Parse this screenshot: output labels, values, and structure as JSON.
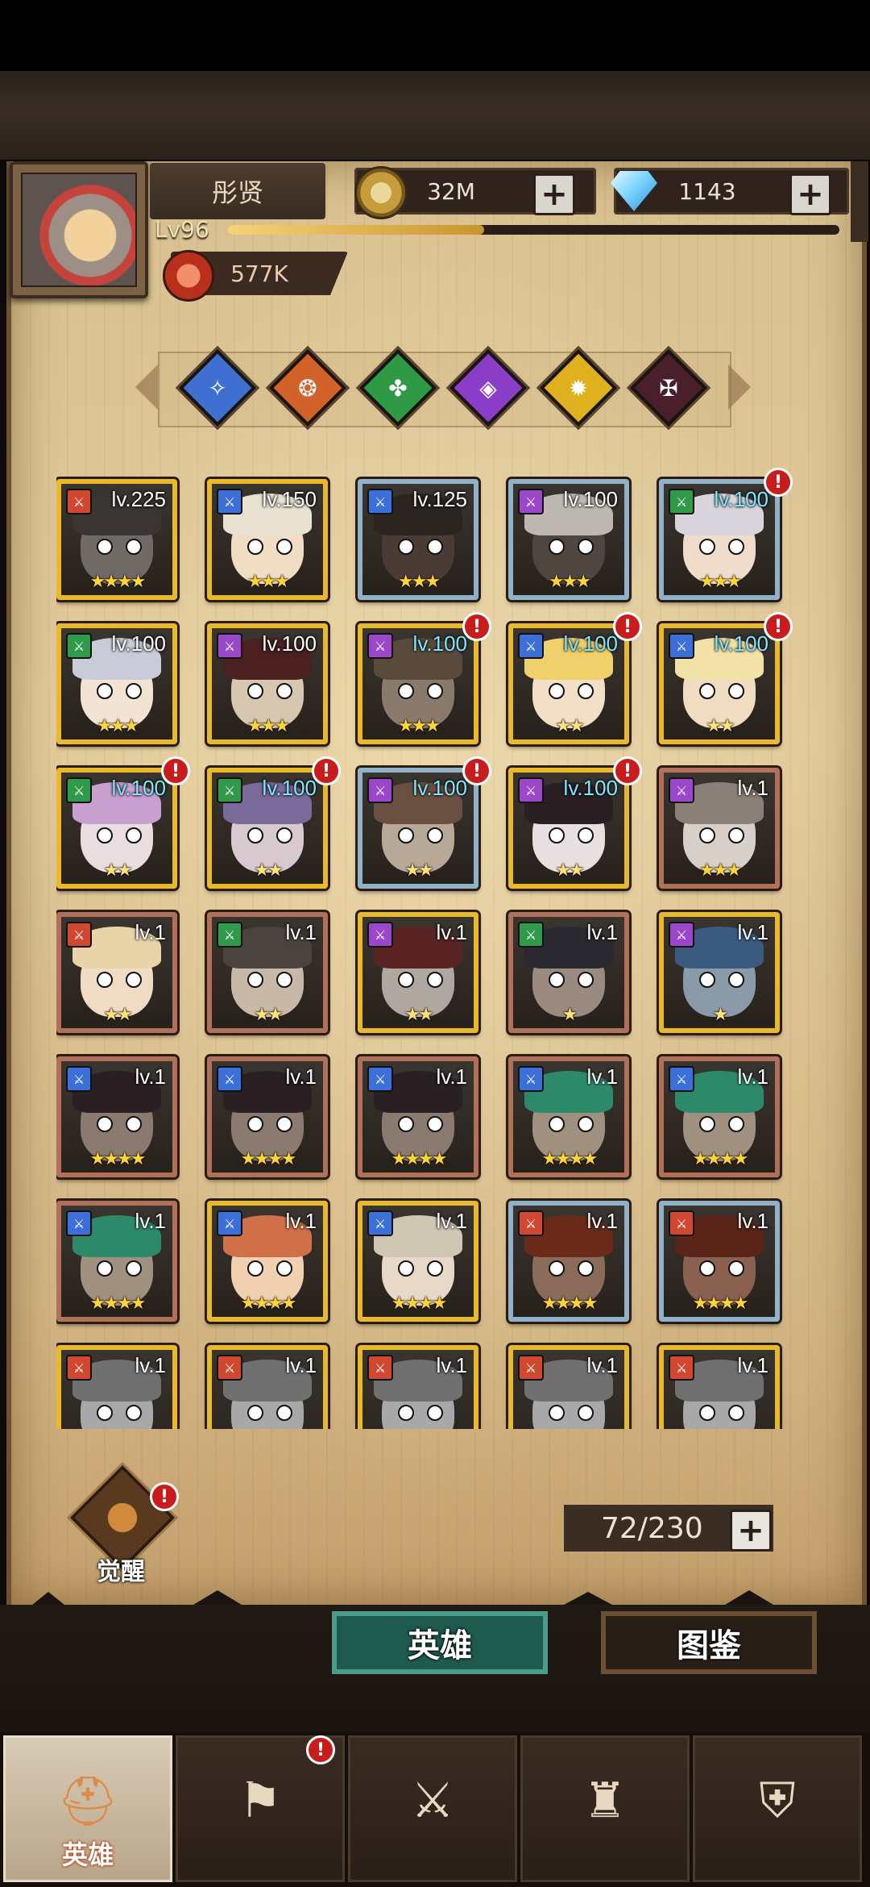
{
  "player": {
    "name": "彤贤",
    "level": "Lv96",
    "xp_fraction": 0.42,
    "power": "577K"
  },
  "currency": {
    "gold": "32M",
    "gems": "1143"
  },
  "factions": [
    {
      "name": "faction-blue",
      "color": "#3f6fd1",
      "glyph": "✧"
    },
    {
      "name": "faction-orange",
      "color": "#d2622a",
      "glyph": "❂"
    },
    {
      "name": "faction-green",
      "color": "#2f9a45",
      "glyph": "✤"
    },
    {
      "name": "faction-purple",
      "color": "#8a3ec7",
      "glyph": "◈"
    },
    {
      "name": "faction-yellow",
      "color": "#e0b11f",
      "glyph": "✹"
    },
    {
      "name": "faction-dark",
      "color": "#4a1e2a",
      "glyph": "✠"
    }
  ],
  "heroes": [
    {
      "level": "lv.225",
      "frame": "gold",
      "cls": "#d04830",
      "stars": 4,
      "badge": false,
      "hi": false,
      "skin": "#6f6a66",
      "hair": "#3a3533"
    },
    {
      "level": "lv.150",
      "frame": "gold",
      "cls": "#3c6fd8",
      "stars": 3,
      "badge": false,
      "hi": false,
      "skin": "#f1dcc4",
      "hair": "#e8e0d0"
    },
    {
      "level": "lv.125",
      "frame": "blue",
      "cls": "#3c6fd8",
      "stars": 3,
      "badge": false,
      "hi": false,
      "skin": "#4a3b35",
      "hair": "#2b2522"
    },
    {
      "level": "lv.100",
      "frame": "blue",
      "cls": "#9a48c9",
      "stars": 3,
      "badge": false,
      "hi": false,
      "skin": "#4f4640",
      "hair": "#bdb8b2"
    },
    {
      "level": "lv.100",
      "frame": "blue",
      "cls": "#2e9a4a",
      "stars": 3,
      "badge": true,
      "hi": true,
      "skin": "#f0dccb",
      "hair": "#d8d6dc"
    },
    {
      "level": "lv.100",
      "frame": "gold",
      "cls": "#2e9a4a",
      "stars": 3,
      "badge": false,
      "hi": false,
      "skin": "#f3e3d3",
      "hair": "#c9ccd8"
    },
    {
      "level": "lv.100",
      "frame": "gold",
      "cls": "#9a48c9",
      "stars": 3,
      "badge": false,
      "hi": false,
      "skin": "#d7c7b0",
      "hair": "#4b2020"
    },
    {
      "level": "lv.100",
      "frame": "gold",
      "cls": "#9a48c9",
      "stars": 3,
      "badge": true,
      "hi": true,
      "skin": "#8a7a6c",
      "hair": "#5a4a3c"
    },
    {
      "level": "lv.100",
      "frame": "gold",
      "cls": "#3c6fd8",
      "stars": 2,
      "badge": true,
      "hi": true,
      "skin": "#f3dfc6",
      "hair": "#f0d06a"
    },
    {
      "level": "lv.100",
      "frame": "gold",
      "cls": "#3c6fd8",
      "stars": 2,
      "badge": true,
      "hi": true,
      "skin": "#f0dcc0",
      "hair": "#f2e2a8"
    },
    {
      "level": "lv.100",
      "frame": "gold",
      "cls": "#2e9a4a",
      "stars": 2,
      "badge": true,
      "hi": true,
      "skin": "#eadde0",
      "hair": "#c8a0d0"
    },
    {
      "level": "lv.100",
      "frame": "gold",
      "cls": "#2e9a4a",
      "stars": 2,
      "badge": true,
      "hi": true,
      "skin": "#d8c8d0",
      "hair": "#7a6a9a"
    },
    {
      "level": "lv.100",
      "frame": "blue",
      "cls": "#9a48c9",
      "stars": 2,
      "badge": true,
      "hi": true,
      "skin": "#b8a898",
      "hair": "#6a5040"
    },
    {
      "level": "lv.100",
      "frame": "gold",
      "cls": "#9a48c9",
      "stars": 2,
      "badge": true,
      "hi": true,
      "skin": "#e8e0e0",
      "hair": "#2a2024"
    },
    {
      "level": "lv.1",
      "frame": "bronze",
      "cls": "#9a48c9",
      "stars": 3,
      "badge": false,
      "hi": false,
      "skin": "#d8d0c8",
      "hair": "#8a8078"
    },
    {
      "level": "lv.1",
      "frame": "bronze",
      "cls": "#d04830",
      "stars": 2,
      "badge": false,
      "hi": false,
      "skin": "#f0dcc4",
      "hair": "#e8d4a8"
    },
    {
      "level": "lv.1",
      "frame": "bronze",
      "cls": "#2e9a4a",
      "stars": 2,
      "badge": false,
      "hi": false,
      "skin": "#c8b8a8",
      "hair": "#4a4440"
    },
    {
      "level": "lv.1",
      "frame": "gold",
      "cls": "#9a48c9",
      "stars": 2,
      "badge": false,
      "hi": false,
      "skin": "#b0a8a0",
      "hair": "#5a2424"
    },
    {
      "level": "lv.1",
      "frame": "bronze",
      "cls": "#2e9a4a",
      "stars": 1,
      "badge": false,
      "hi": false,
      "skin": "#9a8a80",
      "hair": "#2a2830"
    },
    {
      "level": "lv.1",
      "frame": "gold",
      "cls": "#9a48c9",
      "stars": 1,
      "badge": false,
      "hi": false,
      "skin": "#8a9aa8",
      "hair": "#3a5a80"
    },
    {
      "level": "lv.1",
      "frame": "bronze",
      "cls": "#3c6fd8",
      "stars": 4,
      "badge": false,
      "hi": false,
      "skin": "#8a7a70",
      "hair": "#2a2024"
    },
    {
      "level": "lv.1",
      "frame": "bronze",
      "cls": "#3c6fd8",
      "stars": 4,
      "badge": false,
      "hi": false,
      "skin": "#8a7a70",
      "hair": "#2a2024"
    },
    {
      "level": "lv.1",
      "frame": "bronze",
      "cls": "#3c6fd8",
      "stars": 4,
      "badge": false,
      "hi": false,
      "skin": "#8a7a70",
      "hair": "#2a2024"
    },
    {
      "level": "lv.1",
      "frame": "bronze",
      "cls": "#3c6fd8",
      "stars": 4,
      "badge": false,
      "hi": false,
      "skin": "#a09080",
      "hair": "#2c8a6a"
    },
    {
      "level": "lv.1",
      "frame": "bronze",
      "cls": "#3c6fd8",
      "stars": 4,
      "badge": false,
      "hi": false,
      "skin": "#a09080",
      "hair": "#2c8a6a"
    },
    {
      "level": "lv.1",
      "frame": "bronze",
      "cls": "#3c6fd8",
      "stars": 4,
      "badge": false,
      "hi": false,
      "skin": "#a09080",
      "hair": "#2c8a6a"
    },
    {
      "level": "lv.1",
      "frame": "gold",
      "cls": "#3c6fd8",
      "stars": 4,
      "badge": false,
      "hi": false,
      "skin": "#f0d0b0",
      "hair": "#d07048"
    },
    {
      "level": "lv.1",
      "frame": "gold",
      "cls": "#3c6fd8",
      "stars": 4,
      "badge": false,
      "hi": false,
      "skin": "#e8d8c8",
      "hair": "#cfc6b4"
    },
    {
      "level": "lv.1",
      "frame": "blue",
      "cls": "#d04830",
      "stars": 4,
      "badge": false,
      "hi": false,
      "skin": "#8a6a58",
      "hair": "#6a2a1a"
    },
    {
      "level": "lv.1",
      "frame": "blue",
      "cls": "#d04830",
      "stars": 4,
      "badge": false,
      "hi": false,
      "skin": "#8a6050",
      "hair": "#5a2418"
    },
    {
      "level": "lv.1",
      "frame": "gold",
      "cls": "#d04830",
      "stars": 0,
      "badge": false,
      "hi": false,
      "skin": "#a8a8a8",
      "hair": "#707070"
    },
    {
      "level": "lv.1",
      "frame": "gold",
      "cls": "#d04830",
      "stars": 0,
      "badge": false,
      "hi": false,
      "skin": "#a8a8a8",
      "hair": "#707070"
    },
    {
      "level": "lv.1",
      "frame": "gold",
      "cls": "#d04830",
      "stars": 0,
      "badge": false,
      "hi": false,
      "skin": "#a8a8a8",
      "hair": "#707070"
    },
    {
      "level": "lv.1",
      "frame": "gold",
      "cls": "#d04830",
      "stars": 0,
      "badge": false,
      "hi": false,
      "skin": "#a8a8a8",
      "hair": "#707070"
    },
    {
      "level": "lv.1",
      "frame": "gold",
      "cls": "#d04830",
      "stars": 0,
      "badge": false,
      "hi": false,
      "skin": "#a8a8a8",
      "hair": "#707070"
    }
  ],
  "awaken": {
    "label": "觉醒"
  },
  "capacity": "72/230",
  "tabs": {
    "heroes": "英雄",
    "codex": "图鉴"
  },
  "nav": [
    {
      "label": "英雄",
      "icon": "helmet-icon",
      "active": true,
      "badge": false
    },
    {
      "label": "",
      "icon": "ship-flag-icon",
      "active": false,
      "badge": true
    },
    {
      "label": "",
      "icon": "crossed-swords-icon",
      "active": false,
      "badge": false
    },
    {
      "label": "",
      "icon": "castle-icon",
      "active": false,
      "badge": false
    },
    {
      "label": "",
      "icon": "guild-crest-icon",
      "active": false,
      "badge": false
    }
  ],
  "colors": {
    "gold_frame": "#e8b92c",
    "blue_frame": "#8fb2c8",
    "bronze_frame": "#b0705a",
    "badge_red": "#c91d1d"
  }
}
